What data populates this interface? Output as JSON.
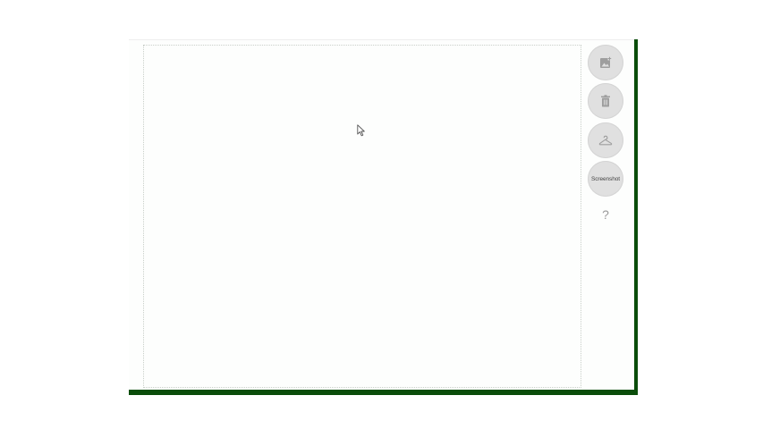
{
  "toolbar": {
    "add_image_icon": "add-image-icon",
    "delete_icon": "trash-icon",
    "hanger_icon": "hanger-icon",
    "screenshot_label": "Screenshot",
    "help_label": "?"
  },
  "colors": {
    "frame_accent": "#0a4d0a",
    "button_bg": "#e0e0e0",
    "icon_gray": "#9e9e9e",
    "canvas_bg": "#fdfefd"
  }
}
